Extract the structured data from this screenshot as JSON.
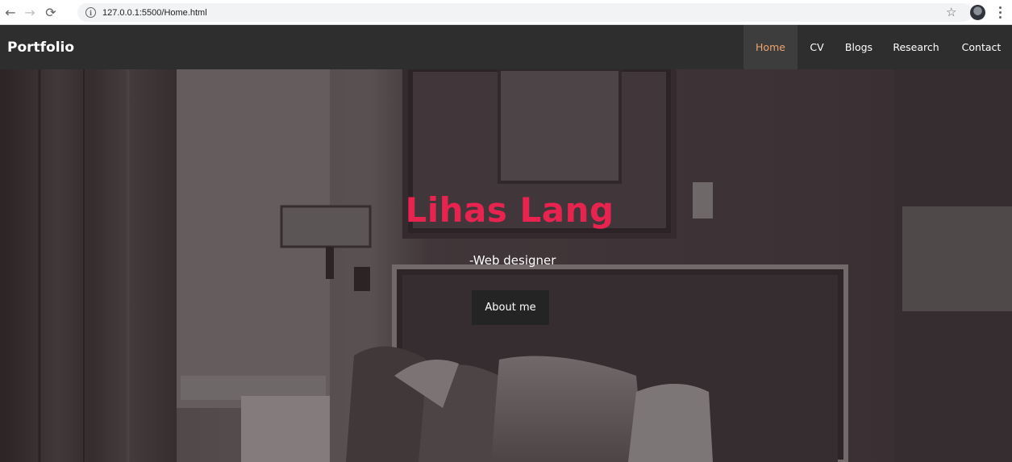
{
  "browser": {
    "url": "127.0.0.1:5500/Home.html",
    "back_icon": "arrow-left-icon",
    "forward_icon": "arrow-right-icon",
    "reload_icon": "reload-icon",
    "star_icon": "star-icon",
    "menu_icon": "kebab-menu-icon"
  },
  "navbar": {
    "brand": "Portfolio",
    "links": [
      {
        "label": "Home",
        "active": true
      },
      {
        "label": "CV",
        "active": false
      },
      {
        "label": "Blogs",
        "active": false
      },
      {
        "label": "Research",
        "active": false
      },
      {
        "label": "Contact",
        "active": false
      }
    ],
    "active_color": "#f0a36e",
    "background": "#2e2e2e"
  },
  "hero": {
    "title": "Lihas Lang",
    "subtitle": "-Web designer",
    "button_label": "About me",
    "title_color": "#e8234f"
  }
}
